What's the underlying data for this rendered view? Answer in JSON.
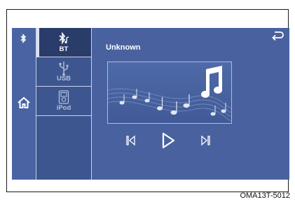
{
  "sources": [
    {
      "label": "BT",
      "icon": "bluetooth-music-icon",
      "active": true
    },
    {
      "label": "USB",
      "icon": "usb-icon",
      "active": false
    },
    {
      "label": "iPod",
      "icon": "ipod-icon",
      "active": false
    }
  ],
  "now_playing": {
    "title": "Unknown"
  },
  "status": {
    "bluetooth_icon": "bluetooth-icon"
  },
  "nav": {
    "home_icon": "home-icon",
    "back_icon": "back-arrow-icon"
  },
  "controls": {
    "prev_icon": "skip-previous-icon",
    "play_icon": "play-icon",
    "next_icon": "skip-next-icon"
  },
  "caption": "OMA13T-5012",
  "colors": {
    "screen": "#49629f",
    "panel": "#3d568f",
    "active": "#2a3c6a",
    "text": "#ffffff"
  }
}
